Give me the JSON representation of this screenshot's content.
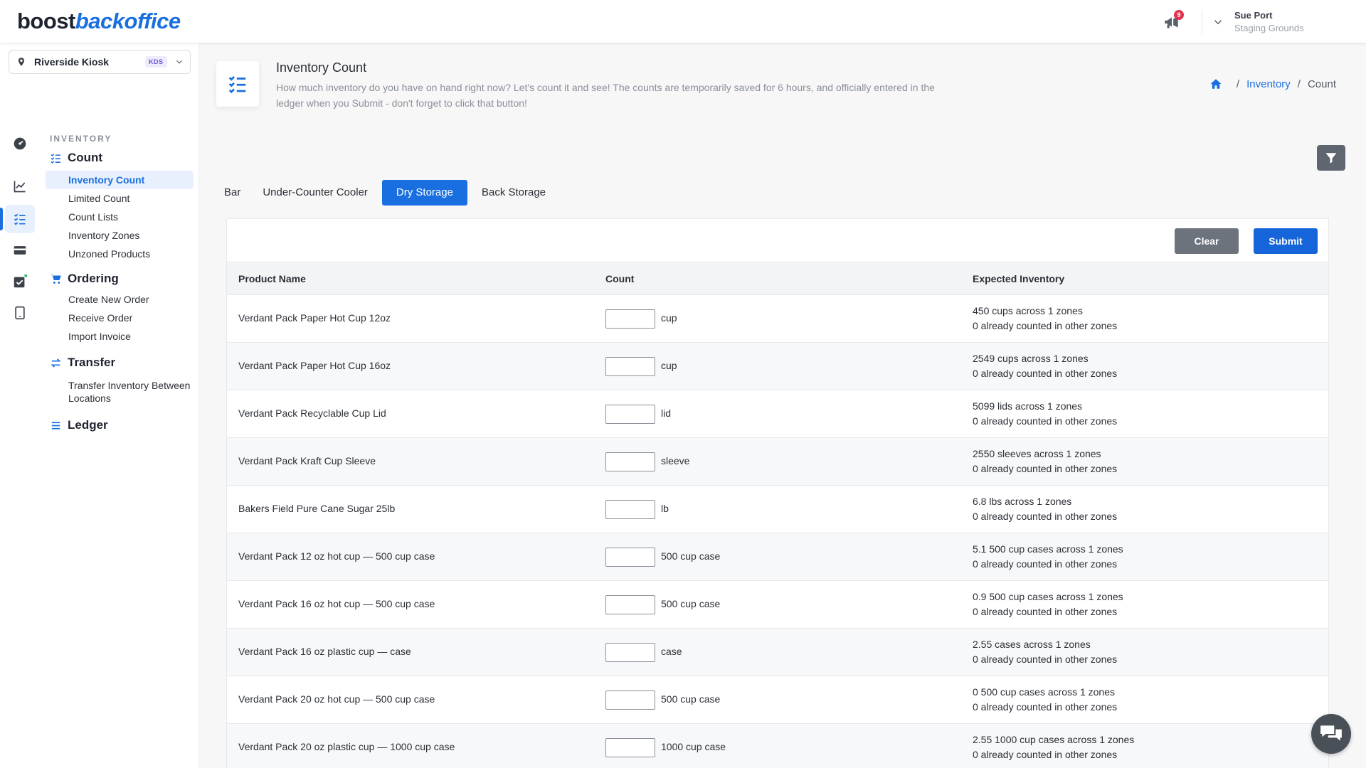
{
  "brand": {
    "part1": "boost",
    "part2": "backoffice"
  },
  "topbar": {
    "notification_count": "9",
    "user_name": "Sue Port",
    "user_org": "Staging Grounds"
  },
  "location": {
    "name": "Riverside Kiosk",
    "badge": "KDS"
  },
  "sidebar": {
    "section": "INVENTORY",
    "groups": [
      {
        "title": "Count",
        "items": [
          "Inventory Count",
          "Limited Count",
          "Count Lists",
          "Inventory Zones",
          "Unzoned Products"
        ]
      },
      {
        "title": "Ordering",
        "items": [
          "Create New Order",
          "Receive Order",
          "Import Invoice"
        ]
      },
      {
        "title": "Transfer",
        "items": [
          "Transfer Inventory Between Locations"
        ]
      },
      {
        "title": "Ledger",
        "items": []
      }
    ]
  },
  "page": {
    "title": "Inventory Count",
    "description": "How much inventory do you have on hand right now? Let's count it and see! The counts are temporarily saved for 6 hours, and officially entered in the ledger when you Submit - don't forget to click that button!"
  },
  "breadcrumb": {
    "inventory": "Inventory",
    "current": "Count"
  },
  "tabs": [
    "Bar",
    "Under-Counter Cooler",
    "Dry Storage",
    "Back Storage"
  ],
  "active_tab": "Dry Storage",
  "actions": {
    "clear": "Clear",
    "submit": "Submit"
  },
  "table": {
    "headers": [
      "Product Name",
      "Count",
      "Expected Inventory"
    ],
    "rows": [
      {
        "name": "Verdant Pack Paper Hot Cup 12oz",
        "unit": "cup",
        "expected": "450 cups across 1 zones",
        "other": "0 already counted in other zones"
      },
      {
        "name": "Verdant Pack Paper Hot Cup 16oz",
        "unit": "cup",
        "expected": "2549 cups across 1 zones",
        "other": "0 already counted in other zones"
      },
      {
        "name": "Verdant Pack Recyclable Cup Lid",
        "unit": "lid",
        "expected": "5099 lids across 1 zones",
        "other": "0 already counted in other zones"
      },
      {
        "name": "Verdant Pack Kraft Cup Sleeve",
        "unit": "sleeve",
        "expected": "2550 sleeves across 1 zones",
        "other": "0 already counted in other zones"
      },
      {
        "name": "Bakers Field Pure Cane Sugar 25lb",
        "unit": "lb",
        "expected": "6.8 lbs across 1 zones",
        "other": "0 already counted in other zones"
      },
      {
        "name": "Verdant Pack 12 oz hot cup — 500 cup case",
        "unit": "500 cup case",
        "expected": "5.1 500 cup cases across 1 zones",
        "other": "0 already counted in other zones"
      },
      {
        "name": "Verdant Pack 16 oz hot cup — 500 cup case",
        "unit": "500 cup case",
        "expected": "0.9 500 cup cases across 1 zones",
        "other": "0 already counted in other zones"
      },
      {
        "name": "Verdant Pack 16 oz plastic cup — case",
        "unit": "case",
        "expected": "2.55 cases across 1 zones",
        "other": "0 already counted in other zones"
      },
      {
        "name": "Verdant Pack 20 oz hot cup — 500 cup case",
        "unit": "500 cup case",
        "expected": "0 500 cup cases across 1 zones",
        "other": "0 already counted in other zones"
      },
      {
        "name": "Verdant Pack 20 oz plastic cup — 1000 cup case",
        "unit": "1000 cup case",
        "expected": "2.55 1000 cup cases across 1 zones",
        "other": "0 already counted in other zones"
      }
    ]
  },
  "colors": {
    "accent": "#1a6fe0",
    "clear_button": "#6c737c",
    "submit_button": "#1664d9",
    "badge": "#e0334d",
    "kds": "#6d55d8"
  },
  "icons": [
    "megaphone-icon",
    "chevron-down-icon",
    "map-pin-icon",
    "dashboard-icon",
    "chart-icon",
    "checklist-icon",
    "card-icon",
    "checkbox-icon",
    "tablet-icon",
    "cart-icon",
    "transfer-icon",
    "ledger-icon",
    "home-icon",
    "filter-icon",
    "chat-icon"
  ]
}
